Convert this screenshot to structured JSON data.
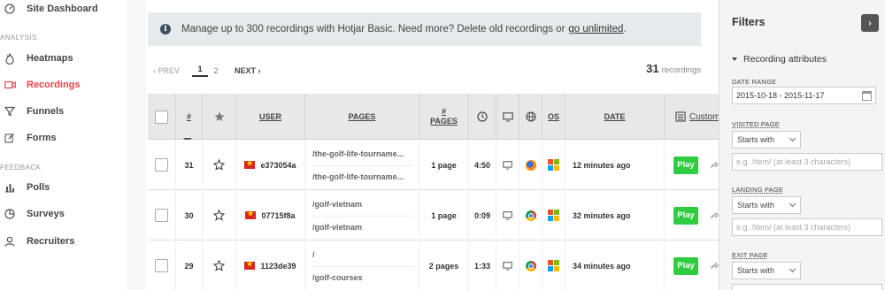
{
  "sidebar": {
    "items": [
      {
        "label": "Site Dashboard",
        "icon": "dashboard-icon"
      },
      {
        "label": "Heatmaps",
        "icon": "flame-icon"
      },
      {
        "label": "Recordings",
        "icon": "video-icon"
      },
      {
        "label": "Funnels",
        "icon": "funnel-icon"
      },
      {
        "label": "Forms",
        "icon": "form-edit-icon"
      },
      {
        "label": "Polls",
        "icon": "bar-chart-icon"
      },
      {
        "label": "Surveys",
        "icon": "pie-chart-icon"
      },
      {
        "label": "Recruiters",
        "icon": "user-icon"
      }
    ],
    "sections": {
      "analysis": "ANALYSIS",
      "feedback": "FEEDBACK"
    },
    "active_color": "#e8434b"
  },
  "notice": {
    "text": "Manage up to 300 recordings with Hotjar Basic. Need more? Delete old recordings or",
    "link": "go unlimited",
    "suffix": "."
  },
  "pager": {
    "prev": "‹ PREV",
    "pages": [
      "1",
      "2"
    ],
    "next": "NEXT ›"
  },
  "total": {
    "count": "31",
    "label": "recordings"
  },
  "table": {
    "headers": {
      "num": "#",
      "user": "USER",
      "pages": "PAGES",
      "num_pages": "# PAGES",
      "os": "OS",
      "date": "DATE",
      "customize": "Customiz"
    },
    "rows": [
      {
        "num": "31",
        "user": "e373054a",
        "pages": [
          "/the-golf-life-tourname...",
          "/the-golf-life-tourname..."
        ],
        "count": "1 page",
        "duration": "4:50",
        "browser": "firefox",
        "date": "12 minutes ago",
        "play": "Play"
      },
      {
        "num": "30",
        "user": "07715f8a",
        "pages": [
          "/golf-vietnam",
          "/golf-vietnam"
        ],
        "count": "1 page",
        "duration": "0:09",
        "browser": "chrome",
        "date": "32 minutes ago",
        "play": "Play"
      },
      {
        "num": "29",
        "user": "1123de39",
        "pages": [
          "/",
          "/golf-courses"
        ],
        "count": "2 pages",
        "duration": "1:33",
        "browser": "chrome",
        "date": "34 minutes ago",
        "play": "Play"
      }
    ]
  },
  "filters": {
    "title": "Filters",
    "collapse": "›",
    "section": "Recording attributes",
    "date_range_label": "DATE RANGE",
    "date_range_value": "2015-10-18 - 2015-11-17",
    "visited_label": "VISITED PAGE",
    "visited_select": "Starts with",
    "visited_placeholder": "e.g. /item/ (at least 3 characters)",
    "landing_label": "LANDING PAGE",
    "landing_select": "Starts with",
    "landing_placeholder": "e.g. /item/ (at least 3 characters)",
    "exit_label": "EXIT PAGE",
    "exit_select": "Starts with"
  }
}
